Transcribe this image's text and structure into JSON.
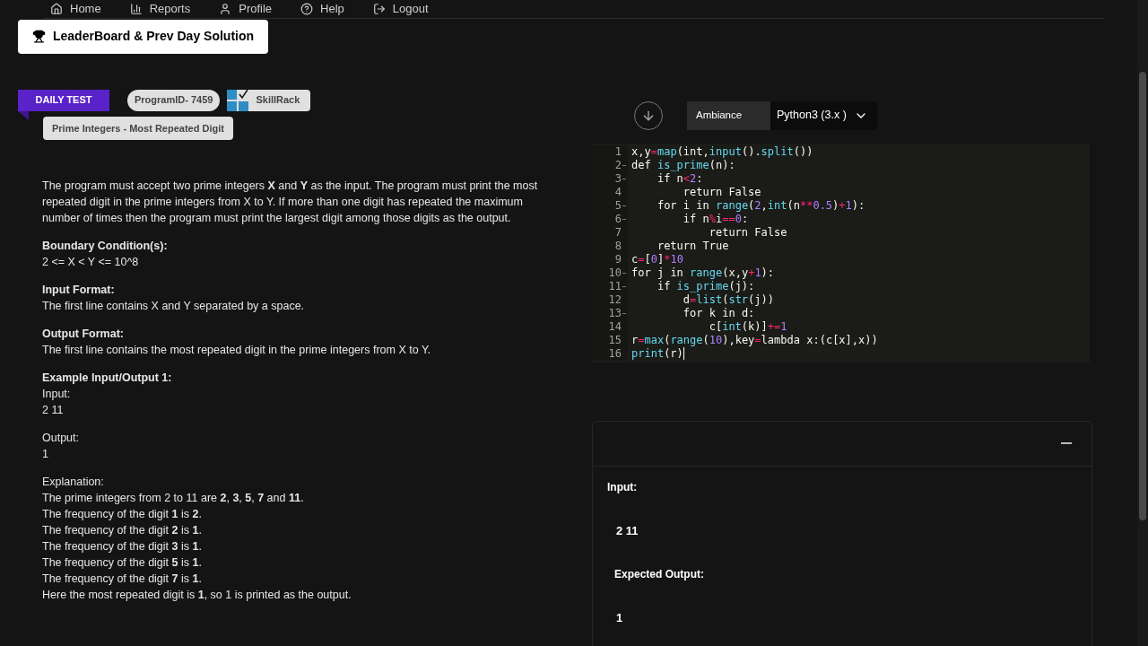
{
  "nav": {
    "items": [
      "Home",
      "Reports",
      "Profile",
      "Help",
      "Logout"
    ]
  },
  "leaderboard_button": "LeaderBoard & Prev Day Solution",
  "ribbon": "DAILY TEST",
  "program_id": "ProgramID- 7459",
  "brand": "SkillRack",
  "problem_title": "Prime Integers - Most Repeated Digit",
  "description": "The program must accept two prime integers **X** and **Y** as the input. The program must print the most repeated digit in the prime integers from X to Y. If more than one digit has repeated the maximum number of times then the program must print the largest digit among those digits as the output.",
  "sections": [
    {
      "heading": "Boundary Condition(s):",
      "lines": [
        "2 <= X < Y <= 10^8"
      ]
    },
    {
      "heading": "Input Format:",
      "lines": [
        "The first line contains X and Y separated by a space."
      ]
    },
    {
      "heading": "Output Format:",
      "lines": [
        "The first line contains the most repeated digit in the prime integers from X to Y."
      ]
    }
  ],
  "example": {
    "heading": "Example Input/Output 1:",
    "input_label": "Input:",
    "input": "2 11",
    "output_label": "Output:",
    "output": "1",
    "explanation_label": "Explanation:",
    "explanation": [
      "The prime integers from 2 to 11 are **2**, **3**, **5**, **7** and **11**.",
      "The frequency of the digit **1** is **2**.",
      "The frequency of the digit **2** is **1**.",
      "The frequency of the digit **3** is **1**.",
      "The frequency of the digit **5** is **1**.",
      "The frequency of the digit **7** is **1**.",
      "Here the most repeated digit is **1**, so 1 is printed as the output."
    ]
  },
  "editor": {
    "theme": "Ambiance",
    "language": "Python3 (3.x )",
    "lines": [
      {
        "n": "1",
        "code": "x,y=map(int,input().split())",
        "fold": false,
        "cursor": false
      },
      {
        "n": "2",
        "code": "def is_prime(n):",
        "fold": true,
        "cursor": false
      },
      {
        "n": "3",
        "code": "    if n<2:",
        "fold": true,
        "cursor": false
      },
      {
        "n": "4",
        "code": "        return False",
        "fold": false,
        "cursor": false
      },
      {
        "n": "5",
        "code": "    for i in range(2,int(n**0.5)+1):",
        "fold": true,
        "cursor": false
      },
      {
        "n": "6",
        "code": "        if n%i==0:",
        "fold": true,
        "cursor": false
      },
      {
        "n": "7",
        "code": "            return False",
        "fold": false,
        "cursor": false
      },
      {
        "n": "8",
        "code": "    return True",
        "fold": false,
        "cursor": false
      },
      {
        "n": "9",
        "code": "c=[0]*10",
        "fold": false,
        "cursor": false
      },
      {
        "n": "10",
        "code": "for j in range(x,y+1):",
        "fold": true,
        "cursor": false
      },
      {
        "n": "11",
        "code": "    if is_prime(j):",
        "fold": true,
        "cursor": false
      },
      {
        "n": "12",
        "code": "        d=list(str(j))",
        "fold": false,
        "cursor": false
      },
      {
        "n": "13",
        "code": "        for k in d:",
        "fold": true,
        "cursor": false
      },
      {
        "n": "14",
        "code": "            c[int(k)]+=1",
        "fold": false,
        "cursor": false
      },
      {
        "n": "15",
        "code": "r=max(range(10),key=lambda x:(c[x],x))",
        "fold": false,
        "cursor": false
      },
      {
        "n": "16",
        "code": "print(r)",
        "fold": false,
        "cursor": true
      }
    ]
  },
  "test_case": {
    "expanded": true,
    "input_label": "Input:",
    "input": "2 11",
    "output_label": "Expected Output:",
    "output": "1"
  }
}
